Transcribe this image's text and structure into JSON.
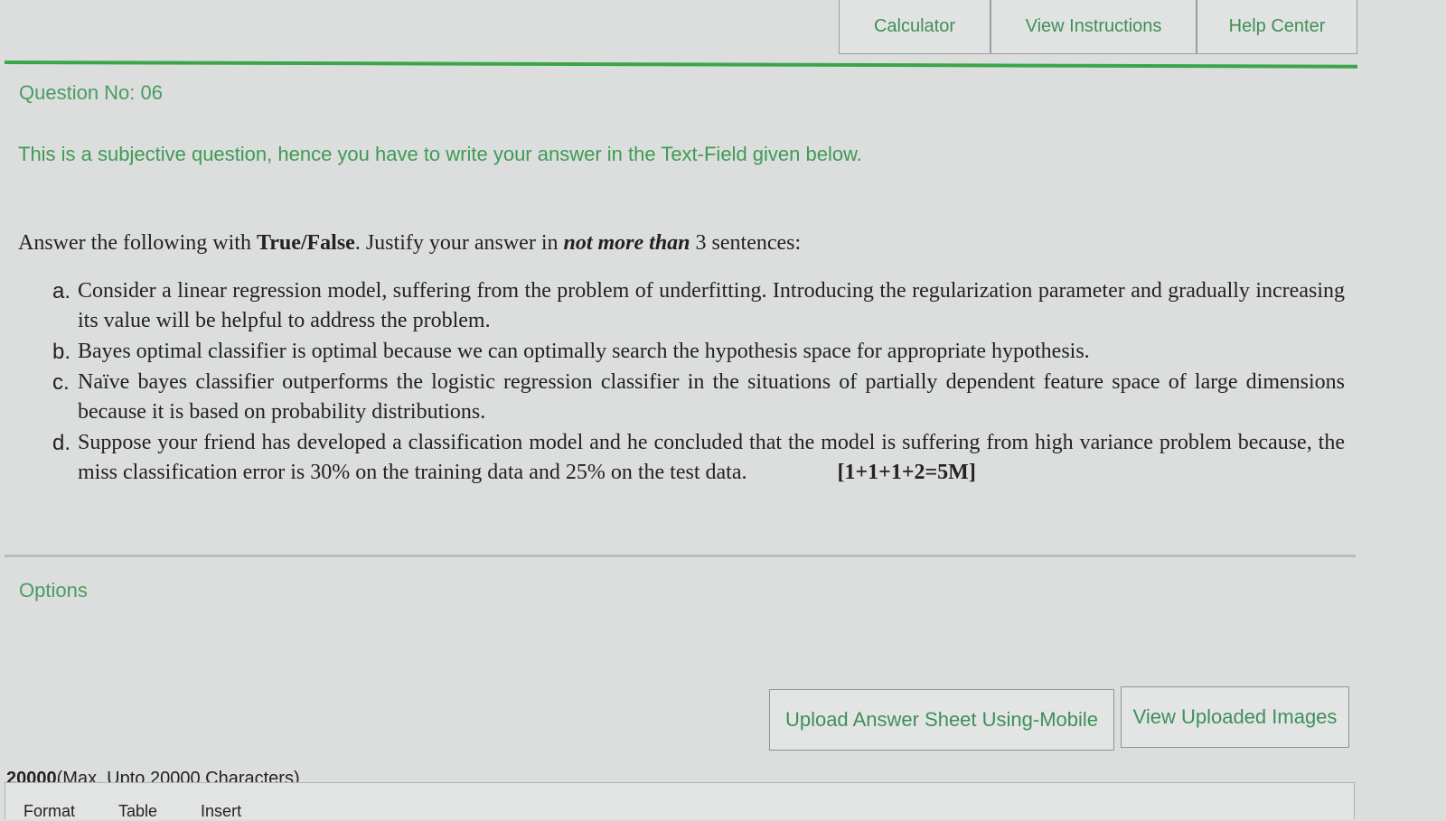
{
  "tabs": {
    "calculator": "Calculator",
    "view_instructions": "View Instructions",
    "help_center": "Help Center"
  },
  "question": {
    "number": "Question No: 06",
    "instruction": "This is a subjective question, hence you have to write your answer in the Text-Field given below.",
    "prompt": {
      "pre": "Answer the following with ",
      "bold": "True/False",
      "mid": ". Justify your answer in ",
      "bold_italic": "not more than",
      "post": " 3 sentences:"
    },
    "items": [
      {
        "label": "a.",
        "text": "Consider a linear regression model, suffering from the problem of underfitting. Introducing the regularization parameter and gradually increasing its value will be helpful to address the problem."
      },
      {
        "label": "b.",
        "text": "Bayes optimal classifier is optimal because we can optimally search the hypothesis space for appropriate hypothesis."
      },
      {
        "label": "c.",
        "text": "Naïve bayes classifier outperforms the logistic regression classifier in the situations of partially dependent feature space of large dimensions because it is based on probability distributions."
      },
      {
        "label": "d.",
        "text": "Suppose your friend has developed a classification model and he concluded that the model is suffering from high variance problem because, the miss classification error is 30% on the training data and 25% on the test data.",
        "marks": "[1+1+1+2=5M]"
      }
    ]
  },
  "options": {
    "heading": "Options"
  },
  "buttons": {
    "upload": "Upload Answer Sheet Using-Mobile",
    "view_uploaded": "View Uploaded Images"
  },
  "char_limit": {
    "value": "20000",
    "label": "(Max. Upto 20000 Characters)"
  },
  "editor_menu": [
    "Format",
    "Table",
    "Insert"
  ]
}
